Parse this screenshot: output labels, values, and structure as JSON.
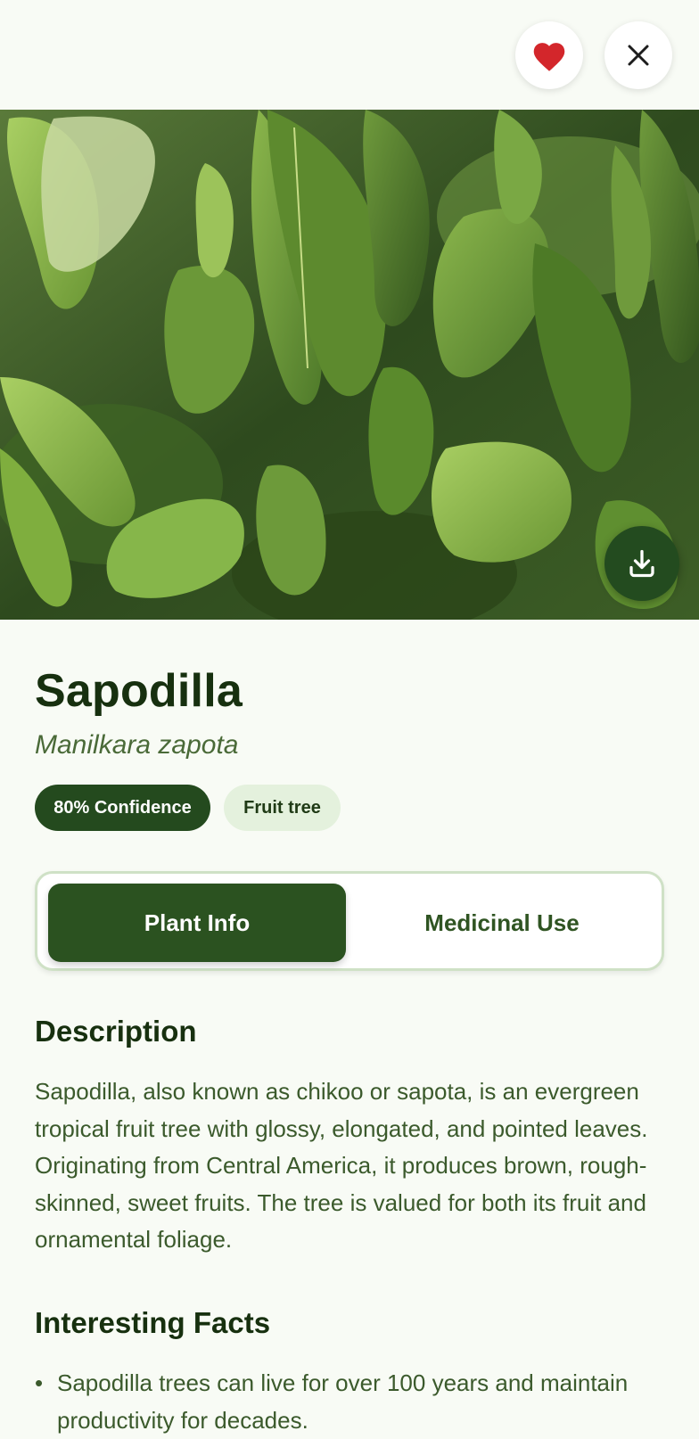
{
  "header": {
    "favorite_icon": "heart-icon",
    "favorite_color": "#d3262b",
    "close_icon": "close-icon"
  },
  "hero": {
    "image_subject": "leaves",
    "download_icon": "download-icon"
  },
  "plant": {
    "common_name": "Sapodilla",
    "scientific_name": "Manilkara zapota",
    "confidence_label": "80% Confidence",
    "category_label": "Fruit tree"
  },
  "tabs": [
    {
      "label": "Plant Info",
      "active": true
    },
    {
      "label": "Medicinal Use",
      "active": false
    }
  ],
  "description": {
    "title": "Description",
    "text": "Sapodilla, also known as chikoo or sapota, is an evergreen tropical fruit tree with glossy, elongated, and pointed leaves. Originating from Central America, it produces brown, rough-skinned, sweet fruits. The tree is valued for both its fruit and ornamental foliage."
  },
  "facts": {
    "title": "Interesting Facts",
    "items": [
      {
        "bullet": "•",
        "text": "Sapodilla trees can live for over 100 years and maintain productivity for decades."
      }
    ]
  },
  "colors": {
    "primary": "#2b5220",
    "background": "#f8fbf5",
    "chip_light": "#e4f1dd",
    "text_dark": "#17300f",
    "text_body": "#3b5a2c"
  }
}
